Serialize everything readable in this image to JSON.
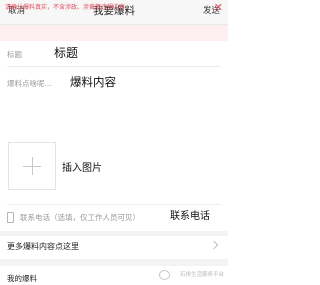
{
  "header": {
    "cancel_label": "取消",
    "title": "我要爆料",
    "send_label": "发送"
  },
  "notice": {
    "text": "请确认爆料真实，不含涉政、涉黄等违规内容",
    "close_icon": "✕"
  },
  "form": {
    "title_placeholder": "标题",
    "title_annotation": "标题",
    "content_placeholder": "爆料点啥呢...",
    "content_annotation": "爆料内容",
    "image_annotation": "插入图片",
    "phone_placeholder": "联系电话（选填，仅工作人员可见）",
    "phone_annotation": "联系电话"
  },
  "more_row": {
    "label": "更多爆料内容点这里"
  },
  "bottom": {
    "my_reports_label": "我的爆料",
    "watermark": "石排生活服务平台"
  },
  "colors": {
    "notice_text": "#e24b5c",
    "notice_bg": "#fdeff0",
    "placeholder": "#9a9a9a"
  }
}
